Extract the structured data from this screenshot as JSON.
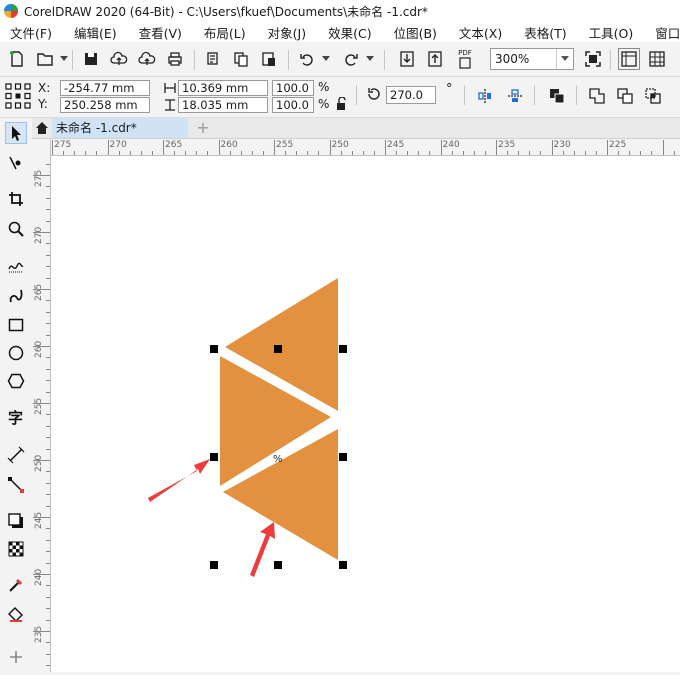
{
  "window": {
    "title": "CorelDRAW 2020 (64-Bit) - C:\\Users\\fkuef\\Documents\\未命名 -1.cdr*"
  },
  "menu": [
    "文件(F)",
    "编辑(E)",
    "查看(V)",
    "布局(L)",
    "对象(J)",
    "效果(C)",
    "位图(B)",
    "文本(X)",
    "表格(T)",
    "工具(O)",
    "窗口"
  ],
  "toolbar": {
    "zoom_value": "300%",
    "pdf_label": "PDF"
  },
  "properties": {
    "x_label": "X:",
    "y_label": "Y:",
    "x_value": "-254.77 mm",
    "y_value": "250.258 mm",
    "width_value": "10.369 mm",
    "height_value": "18.035 mm",
    "scale_x": "100.0",
    "scale_y": "100.0",
    "percent": "%",
    "rotation": "270.0",
    "degree": "°"
  },
  "tabs": {
    "document": "未命名 -1.cdr*",
    "add": "+"
  },
  "ruler": {
    "h_labels": [
      "275",
      "270",
      "265",
      "260",
      "255",
      "250",
      "245",
      "240",
      "235",
      "230",
      "225"
    ],
    "v_labels": [
      "275",
      "270",
      "265",
      "260",
      "255",
      "250",
      "245",
      "240",
      "235"
    ]
  },
  "canvas": {
    "shape_color": "#e3913f",
    "arrow_color": "#ee3b3b",
    "center_mark": "%"
  }
}
